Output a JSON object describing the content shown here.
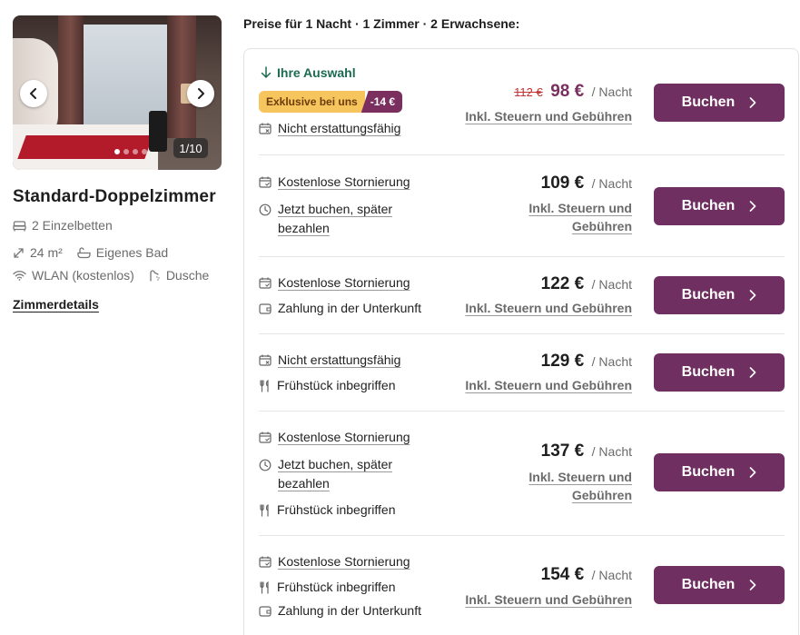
{
  "room": {
    "gallery_counter": "1/10",
    "title": "Standard-Doppelzimmer",
    "beds": "2 Einzelbetten",
    "size": "24 m²",
    "bath": "Eigenes Bad",
    "wifi": "WLAN (kostenlos)",
    "shower": "Dusche",
    "details_link": "Zimmerdetails"
  },
  "prices_heading": "Preise für 1 Nacht · 1 Zimmer · 2 Erwachsene:",
  "common": {
    "per_night": "/ Nacht",
    "taxes_single": "Inkl. Steuern und Gebühren",
    "taxes_line1": "Inkl. Steuern und",
    "taxes_line2": "Gebühren",
    "book_label": "Buchen"
  },
  "offers": [
    {
      "selected_label": "Ihre Auswahl",
      "badge_exclusive": "Exklusive bei uns",
      "badge_discount": "-14 €",
      "feature1": "Nicht erstattungsfähig",
      "old_price": "112 €",
      "price": "98 €"
    },
    {
      "feature1": "Kostenlose Stornierung",
      "feature2_line1": "Jetzt buchen, später",
      "feature2_line2": "bezahlen",
      "price": "109 €"
    },
    {
      "feature1": "Kostenlose Stornierung",
      "feature2": "Zahlung in der Unterkunft",
      "price": "122 €"
    },
    {
      "feature1": "Nicht erstattungsfähig",
      "feature2": "Frühstück inbegriffen",
      "price": "129 €"
    },
    {
      "feature1": "Kostenlose Stornierung",
      "feature2_line1": "Jetzt buchen, später",
      "feature2_line2": "bezahlen",
      "feature3": "Frühstück inbegriffen",
      "price": "137 €"
    },
    {
      "feature1": "Kostenlose Stornierung",
      "feature2": "Frühstück inbegriffen",
      "feature3": "Zahlung in der Unterkunft",
      "price": "154 €"
    }
  ],
  "colors": {
    "brand": "#6f2f60",
    "selected_green": "#1b6b52",
    "badge_yellow": "#f7c55d",
    "strike_red": "#c63131"
  }
}
